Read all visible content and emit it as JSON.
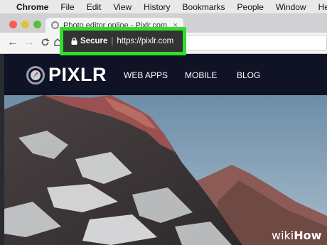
{
  "menubar": {
    "items": [
      "Chrome",
      "File",
      "Edit",
      "View",
      "History",
      "Bookmarks",
      "People",
      "Window",
      "Help"
    ]
  },
  "tab": {
    "title": "Photo editor online - Pixlr.com",
    "close": "×"
  },
  "toolbar": {
    "back": "←",
    "forward": "→",
    "reload": "C"
  },
  "address": {
    "secure": "Secure",
    "separator": "|",
    "url": "https://pixlr.com"
  },
  "site": {
    "brand": "PIXLR",
    "nav": [
      "WEB APPS",
      "MOBILE",
      "BLOG"
    ]
  },
  "watermark": {
    "prefix": "wiki",
    "suffix": "How"
  },
  "colors": {
    "highlight": "#2fe02a",
    "site_bg": "#101226",
    "sky": "#6e8ea8"
  }
}
